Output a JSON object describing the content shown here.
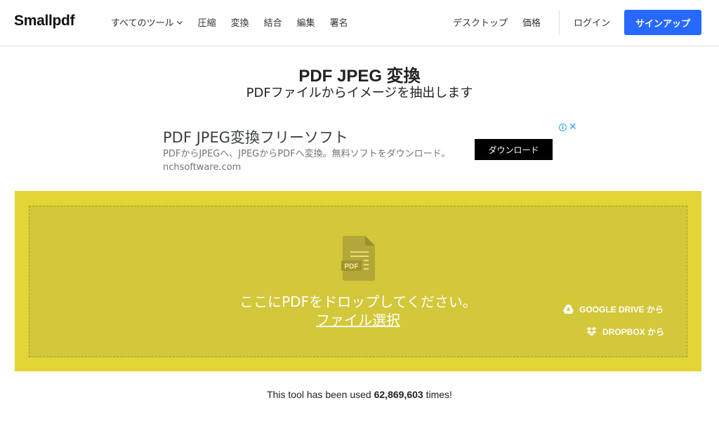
{
  "header": {
    "logo": "Smallpdf",
    "nav": {
      "all_tools": "すべてのツール",
      "compress": "圧縮",
      "convert": "変換",
      "merge": "結合",
      "edit": "編集",
      "sign": "署名"
    },
    "desktop": "デスクトップ",
    "pricing": "価格",
    "login": "ログイン",
    "signup": "サインアップ"
  },
  "page": {
    "title": "PDF JPEG 変換",
    "subtitle": "PDFファイルからイメージを抽出します"
  },
  "ad": {
    "title": "PDF JPEG変換フリーソフト",
    "description": "PDFからJPEGへ、JPEGからPDFへ変換。無料ソフトをダウンロード。 nchsoftware.com",
    "button": "ダウンロード"
  },
  "dropzone": {
    "icon_label": "PDF",
    "drop_text": "ここにPDFをドロップしてください。",
    "choose_file": "ファイル選択",
    "google_drive": "GOOGLE DRIVE から",
    "dropbox": "DROPBOX から"
  },
  "usage": {
    "prefix": "This tool has been used ",
    "count": "62,869,603",
    "suffix": " times!"
  },
  "colors": {
    "brand_blue": "#2768ff",
    "drop_outer": "#e2d535",
    "drop_inner": "#d3c73a"
  }
}
